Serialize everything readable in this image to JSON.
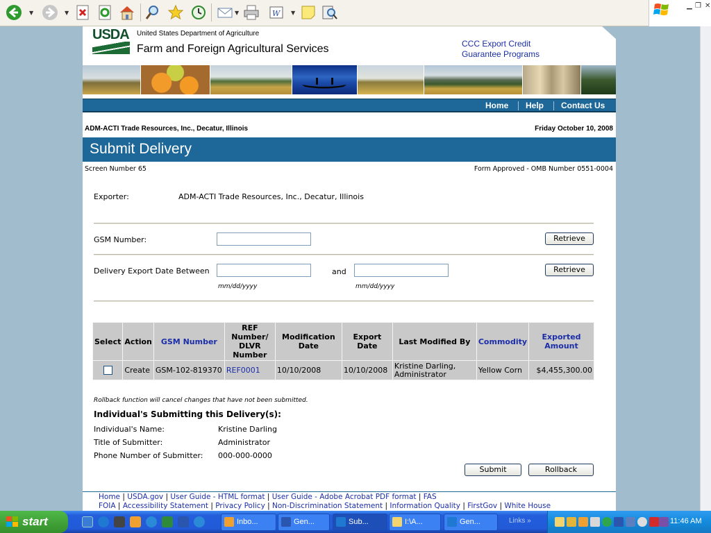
{
  "header": {
    "logo_text": "USDA",
    "department": "United States Department of Agriculture",
    "agency": "Farm and Foreign Agricultural Services",
    "program_line1": "CCC Export Credit",
    "program_line2": "Guarantee Programs"
  },
  "nav": {
    "home": "Home",
    "help": "Help",
    "contact": "Contact Us"
  },
  "company": "ADM-ACTI Trade Resources, Inc., Decatur, Illinois",
  "date": "Friday October 10, 2008",
  "page_title": "Submit Delivery",
  "screen_number": "Screen Number 65",
  "omb": "Form Approved - OMB Number 0551-0004",
  "form": {
    "exporter_label": "Exporter:",
    "exporter_value": "ADM-ACTI Trade Resources, Inc., Decatur, Illinois",
    "gsm_label": "GSM Number:",
    "gsm_value": "",
    "retrieve_label": "Retrieve",
    "date_label": "Delivery Export Date Between",
    "date_from": "",
    "and_label": "and",
    "date_to": "",
    "date_format_hint": "mm/dd/yyyy"
  },
  "table": {
    "headers": [
      "Select",
      "Action",
      "GSM Number",
      "REF Number/ DLVR Number",
      "Modification Date",
      "Export Date",
      "Last Modified By",
      "Commodity",
      "Exported Amount"
    ],
    "rows": [
      {
        "action": "Create",
        "gsm": "GSM-102-819370",
        "ref": "REF0001",
        "mod_date": "10/10/2008",
        "export_date": "10/10/2008",
        "modified_by_line1": "Kristine Darling,",
        "modified_by_line2": "Administrator",
        "commodity": "Yellow Corn",
        "amount": "$4,455,300.00"
      }
    ]
  },
  "rollback_note": "Rollback function will cancel changes that have not been submitted.",
  "individual": {
    "heading": "Individual's Submitting this Delivery(s):",
    "name_label": "Individual's Name:",
    "name_value": "Kristine Darling",
    "title_label": "Title of Submitter:",
    "title_value": "Administrator",
    "phone_label": "Phone Number of Submitter:",
    "phone_value": "000-000-0000"
  },
  "buttons": {
    "submit": "Submit",
    "rollback": "Rollback"
  },
  "footer": {
    "line1": [
      "Home",
      "USDA.gov",
      "User Guide - HTML format",
      "User Guide - Adobe Acrobat PDF format",
      "FAS"
    ],
    "line2": [
      "FOIA",
      "Accessibility Statement",
      "Privacy Policy",
      "Non-Discrimination Statement",
      "Information Quality",
      "FirstGov",
      "White House"
    ]
  },
  "taskbar": {
    "start": "start",
    "tasks": [
      "Inbo...",
      "Gen...",
      "Sub...",
      "I:\\A...",
      "Gen..."
    ],
    "links": "Links",
    "clock": "11:46 AM"
  },
  "colors": {
    "page_blue": "#1d6799",
    "link_blue": "#1b2ea8",
    "usda_green": "#124f2d"
  }
}
